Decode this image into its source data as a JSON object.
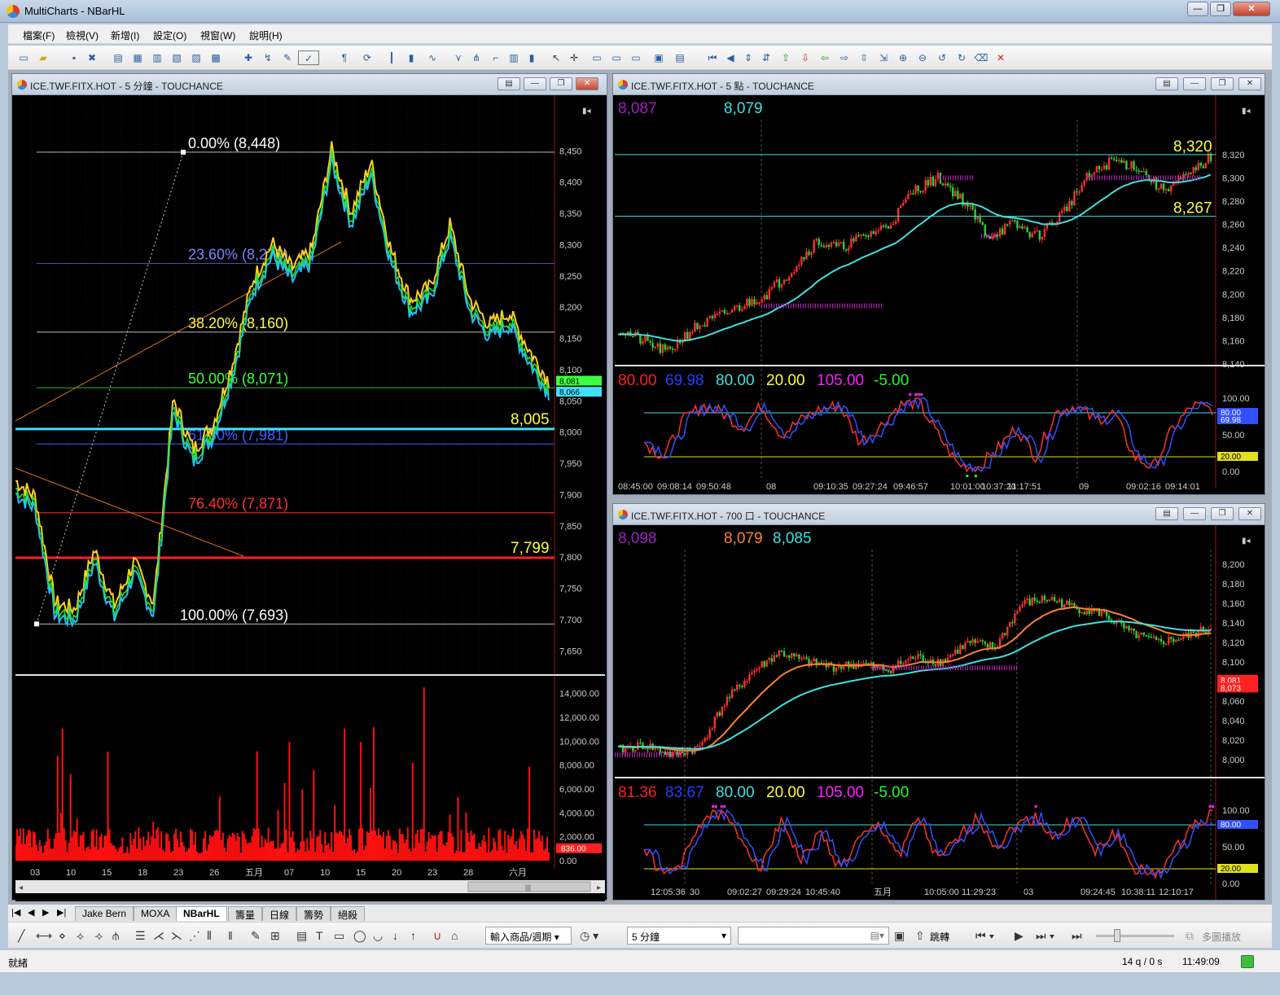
{
  "app": {
    "title": "MultiCharts - NBarHL"
  },
  "menu": [
    "檔案(F)",
    "檢視(V)",
    "新增(I)",
    "設定(O)",
    "視窗(W)",
    "說明(H)"
  ],
  "window_controls": {
    "minimize": "—",
    "restore": "❐",
    "close": "✕"
  },
  "main_chart": {
    "title": "ICE.TWF.FITX.HOT - 5 分鐘 - TOUCHANCE",
    "price_ticks": [
      "8,450",
      "8,400",
      "8,350",
      "8,300",
      "8,250",
      "8,200",
      "8,150",
      "8,100",
      "8,050",
      "8,000",
      "7,950",
      "7,900",
      "7,850",
      "7,800",
      "7,750",
      "7,700",
      "7,650"
    ],
    "fib_labels": [
      "0.00% (8,448)",
      "23.60% (8,270)",
      "38.20% (8,160)",
      "50.00% (8,071)",
      "61.80% (7,981)",
      "76.40% (7,871)",
      "100.00% (7,693)"
    ],
    "fib_colors": [
      "#ffffff",
      "#8080ff",
      "#ffff40",
      "#40ff40",
      "#4060ff",
      "#ff3030",
      "#ffffff"
    ],
    "line_labels": {
      "cyan": "8,005",
      "red": "7,799"
    },
    "price_tags": [
      "8,081",
      "8,066"
    ],
    "volume_ticks": [
      "14,000.00",
      "12,000.00",
      "10,000.00",
      "8,000.00",
      "6,000.00",
      "4,000.00",
      "2,000.00",
      "0.00"
    ],
    "volume_tag": "836.00",
    "date_labels": [
      "03",
      "10",
      "15",
      "18",
      "23",
      "26",
      "五月",
      "07",
      "10",
      "15",
      "20",
      "23",
      "28",
      "六月"
    ],
    "scroll_center": "|||"
  },
  "tr_chart": {
    "title": "ICE.TWF.FITX.HOT - 5 點 - TOUCHANCE",
    "header_values": [
      "8,087",
      "8,079"
    ],
    "header_colors": [
      "#a020c0",
      "#40e0e0"
    ],
    "price_ticks": [
      "8,320",
      "8,300",
      "8,280",
      "8,260",
      "8,240",
      "8,220",
      "8,200",
      "8,180",
      "8,160",
      "8,140"
    ],
    "line_labels": [
      "8,320",
      "8,267"
    ],
    "ind_values": [
      "80.00",
      "69.98",
      "80.00",
      "20.00",
      "105.00",
      "-5.00"
    ],
    "ind_colors": [
      "#ff2020",
      "#2040ff",
      "#40e0e0",
      "#ffff40",
      "#ff20ff",
      "#20ff20"
    ],
    "ind_ticks": [
      "100.00",
      "50.00",
      "0.00"
    ],
    "ind_tags": [
      "80.00",
      "69.98",
      "20.00"
    ],
    "time_labels": [
      "08:45:00",
      "09:08:14",
      "09:50:48",
      "08",
      "09:10:35",
      "09:27:24",
      "09:46:57",
      "10:01:00",
      "10:37:20",
      "11:17:51",
      "09",
      "09:02:16",
      "09:14:01"
    ]
  },
  "br_chart": {
    "title": "ICE.TWF.FITX.HOT - 700 口 - TOUCHANCE",
    "header_values": [
      "8,098",
      "8,079",
      "8,085"
    ],
    "header_colors": [
      "#a020c0",
      "#ff8030",
      "#40e0e0"
    ],
    "price_ticks": [
      "8,200",
      "8,180",
      "8,160",
      "8,140",
      "8,120",
      "8,100",
      "8,080",
      "8,060",
      "8,040",
      "8,020",
      "8,000"
    ],
    "price_tags": [
      "8,081",
      "8,073"
    ],
    "ind_values": [
      "81.36",
      "83.67",
      "80.00",
      "20.00",
      "105.00",
      "-5.00"
    ],
    "ind_colors": [
      "#ff2020",
      "#2040ff",
      "#40e0e0",
      "#ffff40",
      "#ff20ff",
      "#20ff20"
    ],
    "ind_ticks": [
      "100.00",
      "50.00",
      "0.00"
    ],
    "ind_tags": [
      "80.00",
      "20.00"
    ],
    "time_labels": [
      "12:05:36",
      "30",
      "09:02:27",
      "09:29:24",
      "10:45:40",
      "五月",
      "10:05:00",
      "11:29:23",
      "03",
      "09:24:45",
      "10:38:11",
      "12:10:17"
    ]
  },
  "tabs": [
    "Jake Bern",
    "MOXA",
    "NBarHL",
    "籌量",
    "日線",
    "籌勢",
    "絕殺"
  ],
  "active_tab": "NBarHL",
  "drawbar": {
    "symbol_placeholder": "輸入商品/週期",
    "interval": "5 分鐘",
    "jump": "跳轉",
    "multi_play": "多圖播放"
  },
  "status": {
    "left": "就緒",
    "quote_rate": "14 q / 0 s",
    "clock": "11:49:09"
  }
}
